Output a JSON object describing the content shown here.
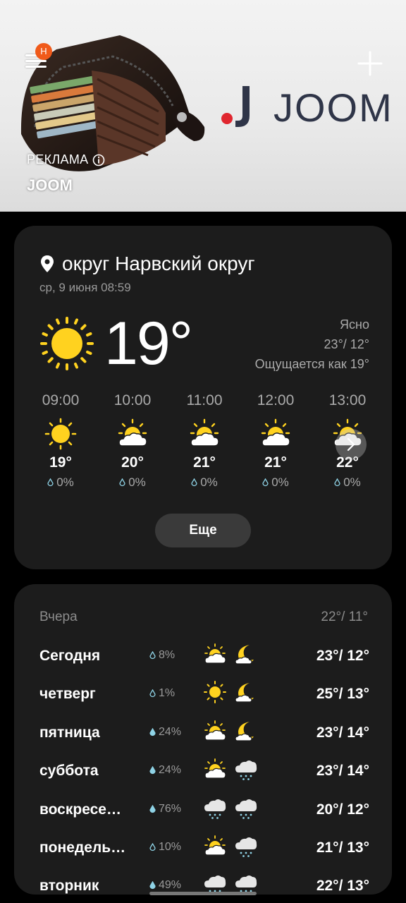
{
  "ad": {
    "badge": "Н",
    "label": "РЕКЛАМА",
    "brand": "JOOM",
    "logo_text": "JOOM"
  },
  "current": {
    "location": "округ Нарвский округ",
    "datetime": "ср, 9 июня 08:59",
    "temperature": "19°",
    "condition": "Ясно",
    "high_low": "23°/ 12°",
    "feels_like": "Ощущается как 19°",
    "hourly": [
      {
        "time": "09:00",
        "icon": "sun-icon",
        "temp": "19°",
        "precip": "0%"
      },
      {
        "time": "10:00",
        "icon": "partly-cloudy-icon",
        "temp": "20°",
        "precip": "0%"
      },
      {
        "time": "11:00",
        "icon": "partly-cloudy-icon",
        "temp": "21°",
        "precip": "0%"
      },
      {
        "time": "12:00",
        "icon": "partly-cloudy-icon",
        "temp": "21°",
        "precip": "0%"
      },
      {
        "time": "13:00",
        "icon": "partly-cloudy-icon",
        "temp": "22°",
        "precip": "0%"
      }
    ],
    "more_label": "Еще"
  },
  "daily": {
    "yesterday_label": "Вчера",
    "yesterday_temps": "22°/ 11°",
    "days": [
      {
        "name": "Сегодня",
        "precip": "8%",
        "day_icon": "partly-cloudy-icon",
        "night_icon": "moon-cloud-icon",
        "temps": "23°/ 12°"
      },
      {
        "name": "четверг",
        "precip": "1%",
        "day_icon": "sun-icon",
        "night_icon": "moon-cloud-icon",
        "temps": "25°/ 13°"
      },
      {
        "name": "пятница",
        "precip": "24%",
        "day_icon": "partly-cloudy-icon",
        "night_icon": "moon-cloud-icon",
        "temps": "23°/ 14°"
      },
      {
        "name": "суббота",
        "precip": "24%",
        "day_icon": "partly-cloudy-icon",
        "night_icon": "rain-cloud-icon",
        "temps": "23°/ 14°"
      },
      {
        "name": "воскресе…",
        "precip": "76%",
        "day_icon": "rain-cloud-icon",
        "night_icon": "rain-cloud-icon",
        "temps": "20°/ 12°"
      },
      {
        "name": "понедель…",
        "precip": "10%",
        "day_icon": "partly-cloudy-icon",
        "night_icon": "rain-cloud-icon",
        "temps": "21°/ 13°"
      },
      {
        "name": "вторник",
        "precip": "49%",
        "day_icon": "rain-cloud-icon",
        "night_icon": "rain-cloud-icon",
        "temps": "22°/ 13°"
      }
    ]
  },
  "colors": {
    "background": "#000000",
    "card": "#1c1c1c",
    "sun": "#ffd21f",
    "secondary_text": "#9a9a9a",
    "joom_red": "#e0262f",
    "joom_navy": "#2f3548"
  }
}
